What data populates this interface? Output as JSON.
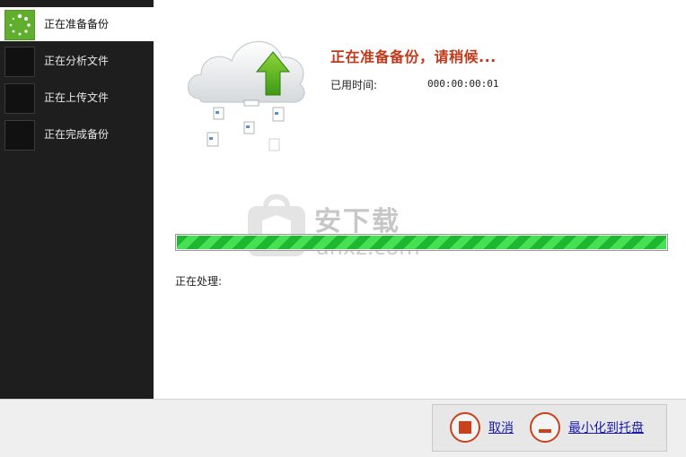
{
  "sidebar": {
    "steps": [
      {
        "label": "正在准备备份",
        "state": "active",
        "icon": "spinner-icon"
      },
      {
        "label": "正在分析文件",
        "state": "pending"
      },
      {
        "label": "正在上传文件",
        "state": "pending"
      },
      {
        "label": "正在完成备份",
        "state": "pending"
      }
    ]
  },
  "main": {
    "title": "正在准备备份，请稍候...",
    "elapsed_label": "已用时间:",
    "elapsed_value": "000:00:00:01",
    "progress_percent": 100,
    "processing_label": "正在处理:",
    "illustration_icon": "cloud-upload-icon"
  },
  "watermark": {
    "text": "安下载",
    "subtext": "anxz.com"
  },
  "footer": {
    "cancel_label": "取消",
    "minimize_label": "最小化到托盘"
  },
  "colors": {
    "accent_title": "#c0391a",
    "progress_green": "#1fb632",
    "sidebar_bg": "#1e1e1e",
    "active_step_green": "#5fae2e",
    "link_blue": "#1a1aa8"
  }
}
